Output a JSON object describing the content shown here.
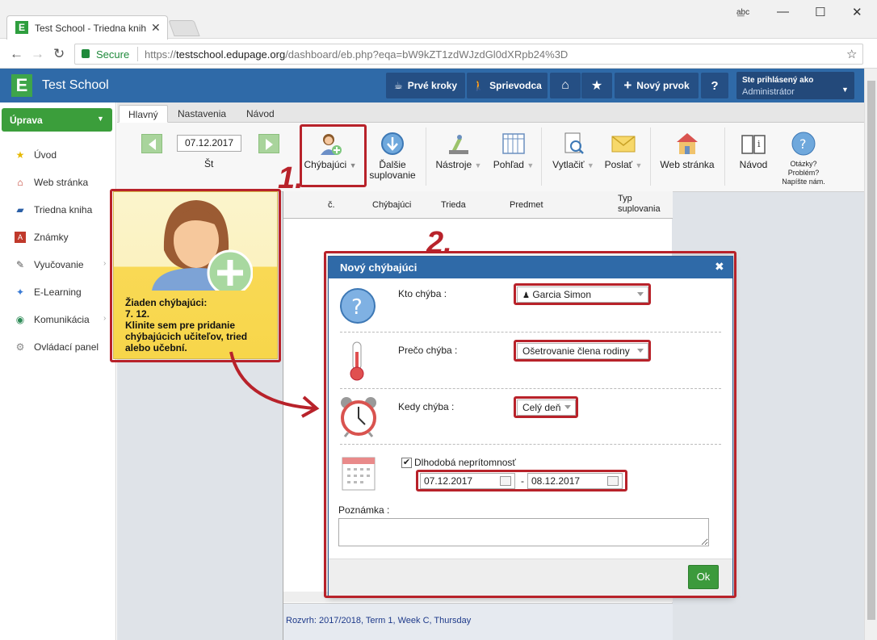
{
  "browser": {
    "tab_title": "Test School - Triedna knih",
    "url_secure_label": "Secure",
    "url_scheme": "https://",
    "url_host": "testschool.edupage.org",
    "url_path": "/dashboard/eb.php?eqa=bW9kZT1zdWJzdGl0dXRpb24%3D"
  },
  "header": {
    "school_name": "Test School",
    "btn_first_steps": "Prvé kroky",
    "btn_guide": "Sprievodca",
    "btn_new_item": "Nový prvok",
    "btn_help": "?",
    "user_label": "Ste prihlásený ako",
    "user_name": "Administrátor"
  },
  "sidebar": {
    "edit_button": "Úprava",
    "items": [
      {
        "label": "Úvod",
        "icon": "star-icon"
      },
      {
        "label": "Web stránka",
        "icon": "web-icon"
      },
      {
        "label": "Triedna kniha",
        "icon": "book-icon"
      },
      {
        "label": "Známky",
        "icon": "grades-icon"
      },
      {
        "label": "Vyučovanie",
        "icon": "teaching-icon"
      },
      {
        "label": "E-Learning",
        "icon": "elearning-icon"
      },
      {
        "label": "Komunikácia",
        "icon": "communication-icon"
      },
      {
        "label": "Ovládací panel",
        "icon": "control-panel-icon"
      }
    ]
  },
  "tabs": [
    "Hlavný",
    "Nastavenia",
    "Návod"
  ],
  "toolbar": {
    "date": "07.12.2017",
    "day": "Št",
    "absent": "Chýbajúci",
    "next_sub_1": "Ďalšie",
    "next_sub_2": "suplovanie",
    "tools": "Nástroje",
    "view": "Pohľad",
    "print": "Vytlačiť",
    "send": "Poslať",
    "web": "Web stránka",
    "guide": "Návod",
    "questions_1": "Otázky?",
    "questions_2": "Problém?",
    "questions_3": "Napíšte nám."
  },
  "table": {
    "headers": [
      "č.",
      "Chýbajúci",
      "Trieda",
      "Predmet",
      "Typ",
      "suplovania"
    ],
    "footer": "Rozvrh: 2017/2018, Term 1, Week C, Thursday"
  },
  "callout": {
    "line1": "Žiaden chýbajúci:",
    "line2": "7. 12.",
    "line3": "Klinite sem pre pridanie",
    "line4": "chýbajúcich učiteľov, tried",
    "line5": "alebo učební."
  },
  "annotations": {
    "step1": "1.",
    "step2": "2."
  },
  "dialog": {
    "title": "Nový chýbajúci",
    "who_label": "Kto chýba :",
    "who_value": "Garcia Simon",
    "why_label": "Prečo chýba :",
    "why_value": "Ošetrovanie člena rodiny",
    "when_label": "Kedy chýba :",
    "when_value": "Celý deň",
    "longterm_label": "Dlhodobá neprítomnosť",
    "longterm_checked": true,
    "date_from": "07.12.2017",
    "date_to": "08.12.2017",
    "date_sep": "-",
    "note_label": "Poznámka :",
    "ok": "Ok"
  },
  "colors": {
    "header_blue": "#2f6aa8",
    "green": "#3b9e3b",
    "annotation_red": "#b8222a"
  }
}
